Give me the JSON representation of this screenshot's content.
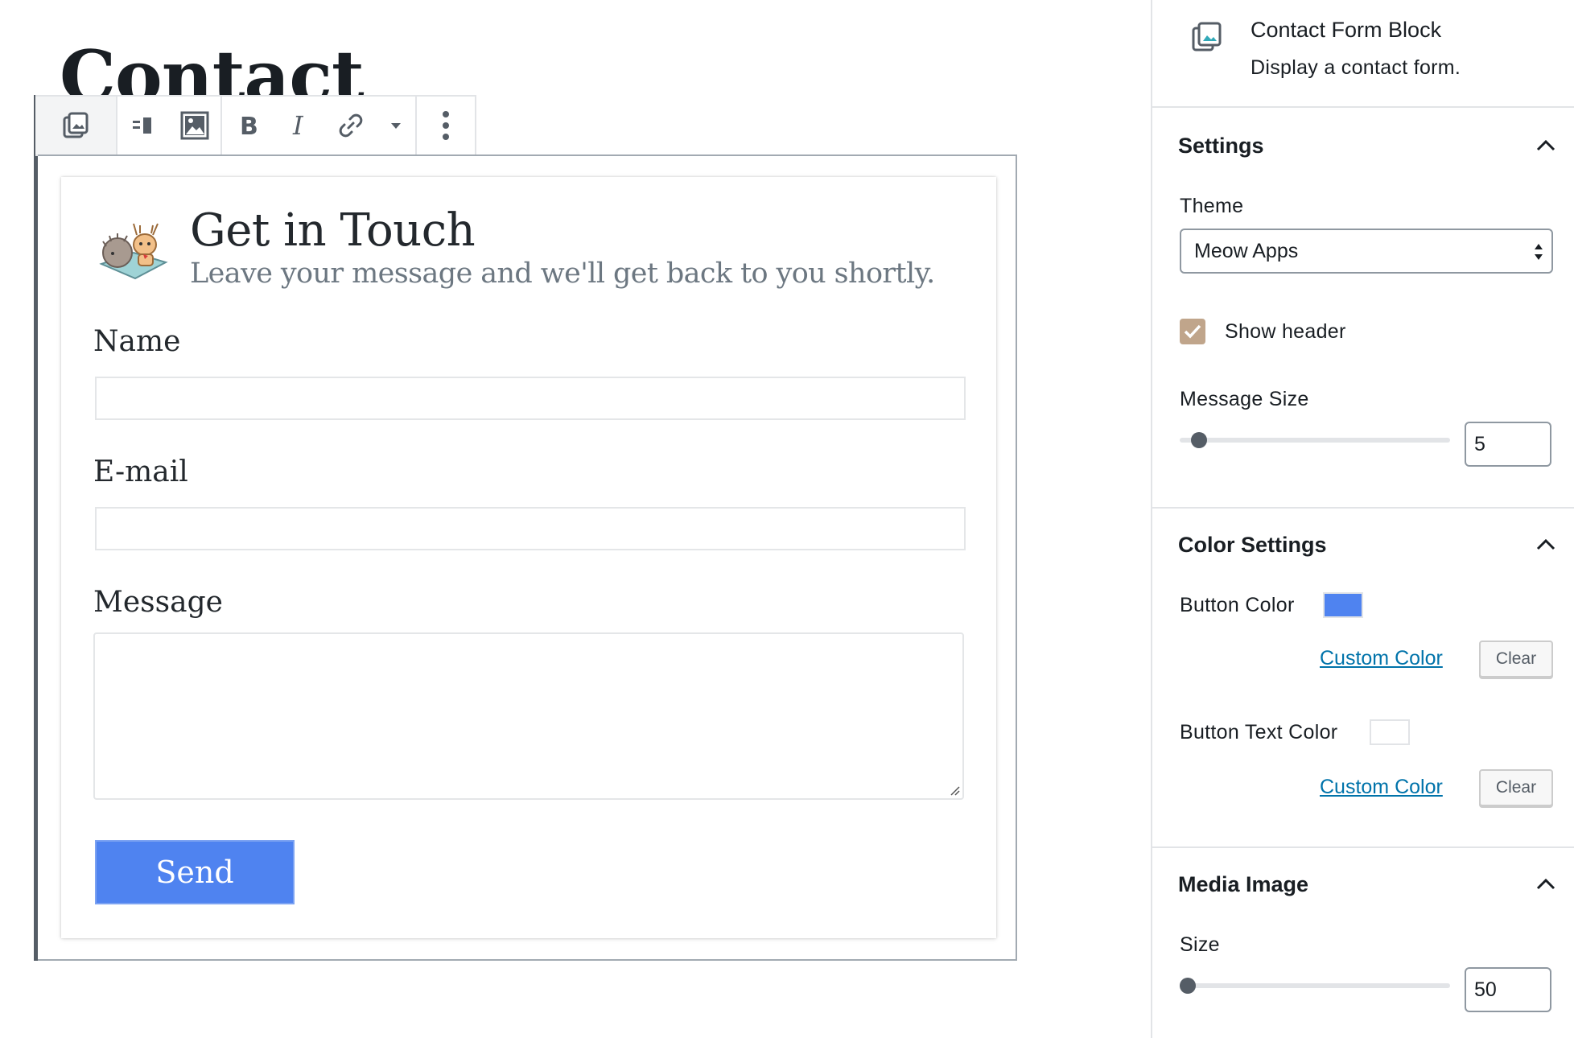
{
  "editor": {
    "post_title": "Contact",
    "toolbar": {
      "buttons": [
        "block-type-icon",
        "align-icon",
        "image-icon",
        "bold-icon",
        "italic-icon",
        "link-icon",
        "dropdown-arrow-icon",
        "more-options-icon"
      ]
    },
    "form": {
      "title": "Get in Touch",
      "subtitle": "Leave your message and we'll get back to you shortly.",
      "name_label": "Name",
      "email_label": "E-mail",
      "message_label": "Message",
      "name_value": "",
      "email_value": "",
      "message_value": "",
      "send_label": "Send",
      "send_color": "#4f83f0"
    }
  },
  "sidebar": {
    "block": {
      "title": "Contact Form Block",
      "description": "Display a contact form."
    },
    "settings": {
      "heading": "Settings",
      "theme_label": "Theme",
      "theme_value": "Meow Apps",
      "show_header_label": "Show header",
      "show_header_checked": true,
      "message_size_label": "Message Size",
      "message_size_value": "5",
      "message_size_fraction": 0.07
    },
    "color_settings": {
      "heading": "Color Settings",
      "button_color_label": "Button Color",
      "button_color": "#4f83f0",
      "button_text_color_label": "Button Text Color",
      "button_text_color": "#ffffff",
      "custom_color_label": "Custom Color",
      "clear_label": "Clear"
    },
    "media_image": {
      "heading": "Media Image",
      "size_label": "Size",
      "size_value": "50",
      "size_fraction": 0.03
    }
  }
}
